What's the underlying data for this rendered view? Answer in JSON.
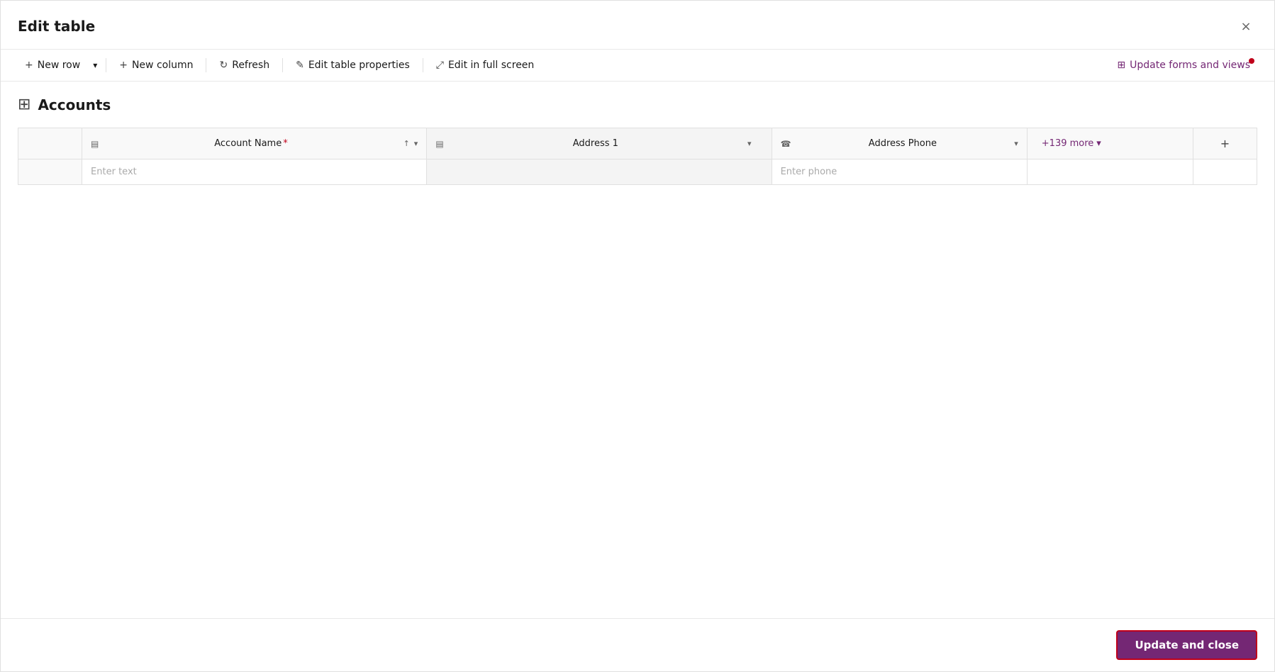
{
  "dialog": {
    "title": "Edit table",
    "close_label": "×"
  },
  "toolbar": {
    "new_row_label": "New row",
    "new_column_label": "New column",
    "refresh_label": "Refresh",
    "edit_table_properties_label": "Edit table properties",
    "edit_in_full_screen_label": "Edit in full screen",
    "update_forms_label": "Update forms and views"
  },
  "table": {
    "title": "Accounts",
    "columns": [
      {
        "id": "account_name",
        "label": "Account Name",
        "required": true,
        "icon": "table-field",
        "has_sort": true,
        "has_dropdown": true
      },
      {
        "id": "address1",
        "label": "Address 1",
        "icon": "table-field",
        "has_dropdown": true,
        "has_edit": true
      },
      {
        "id": "address_phone",
        "label": "Address Phone",
        "icon": "phone",
        "has_dropdown": true
      }
    ],
    "more_columns_label": "+139 more",
    "add_column_icon": "+",
    "rows": [
      {
        "account_name_placeholder": "Enter text",
        "address1_value": "",
        "address_phone_placeholder": "Enter phone"
      }
    ]
  },
  "footer": {
    "update_close_label": "Update and close"
  }
}
